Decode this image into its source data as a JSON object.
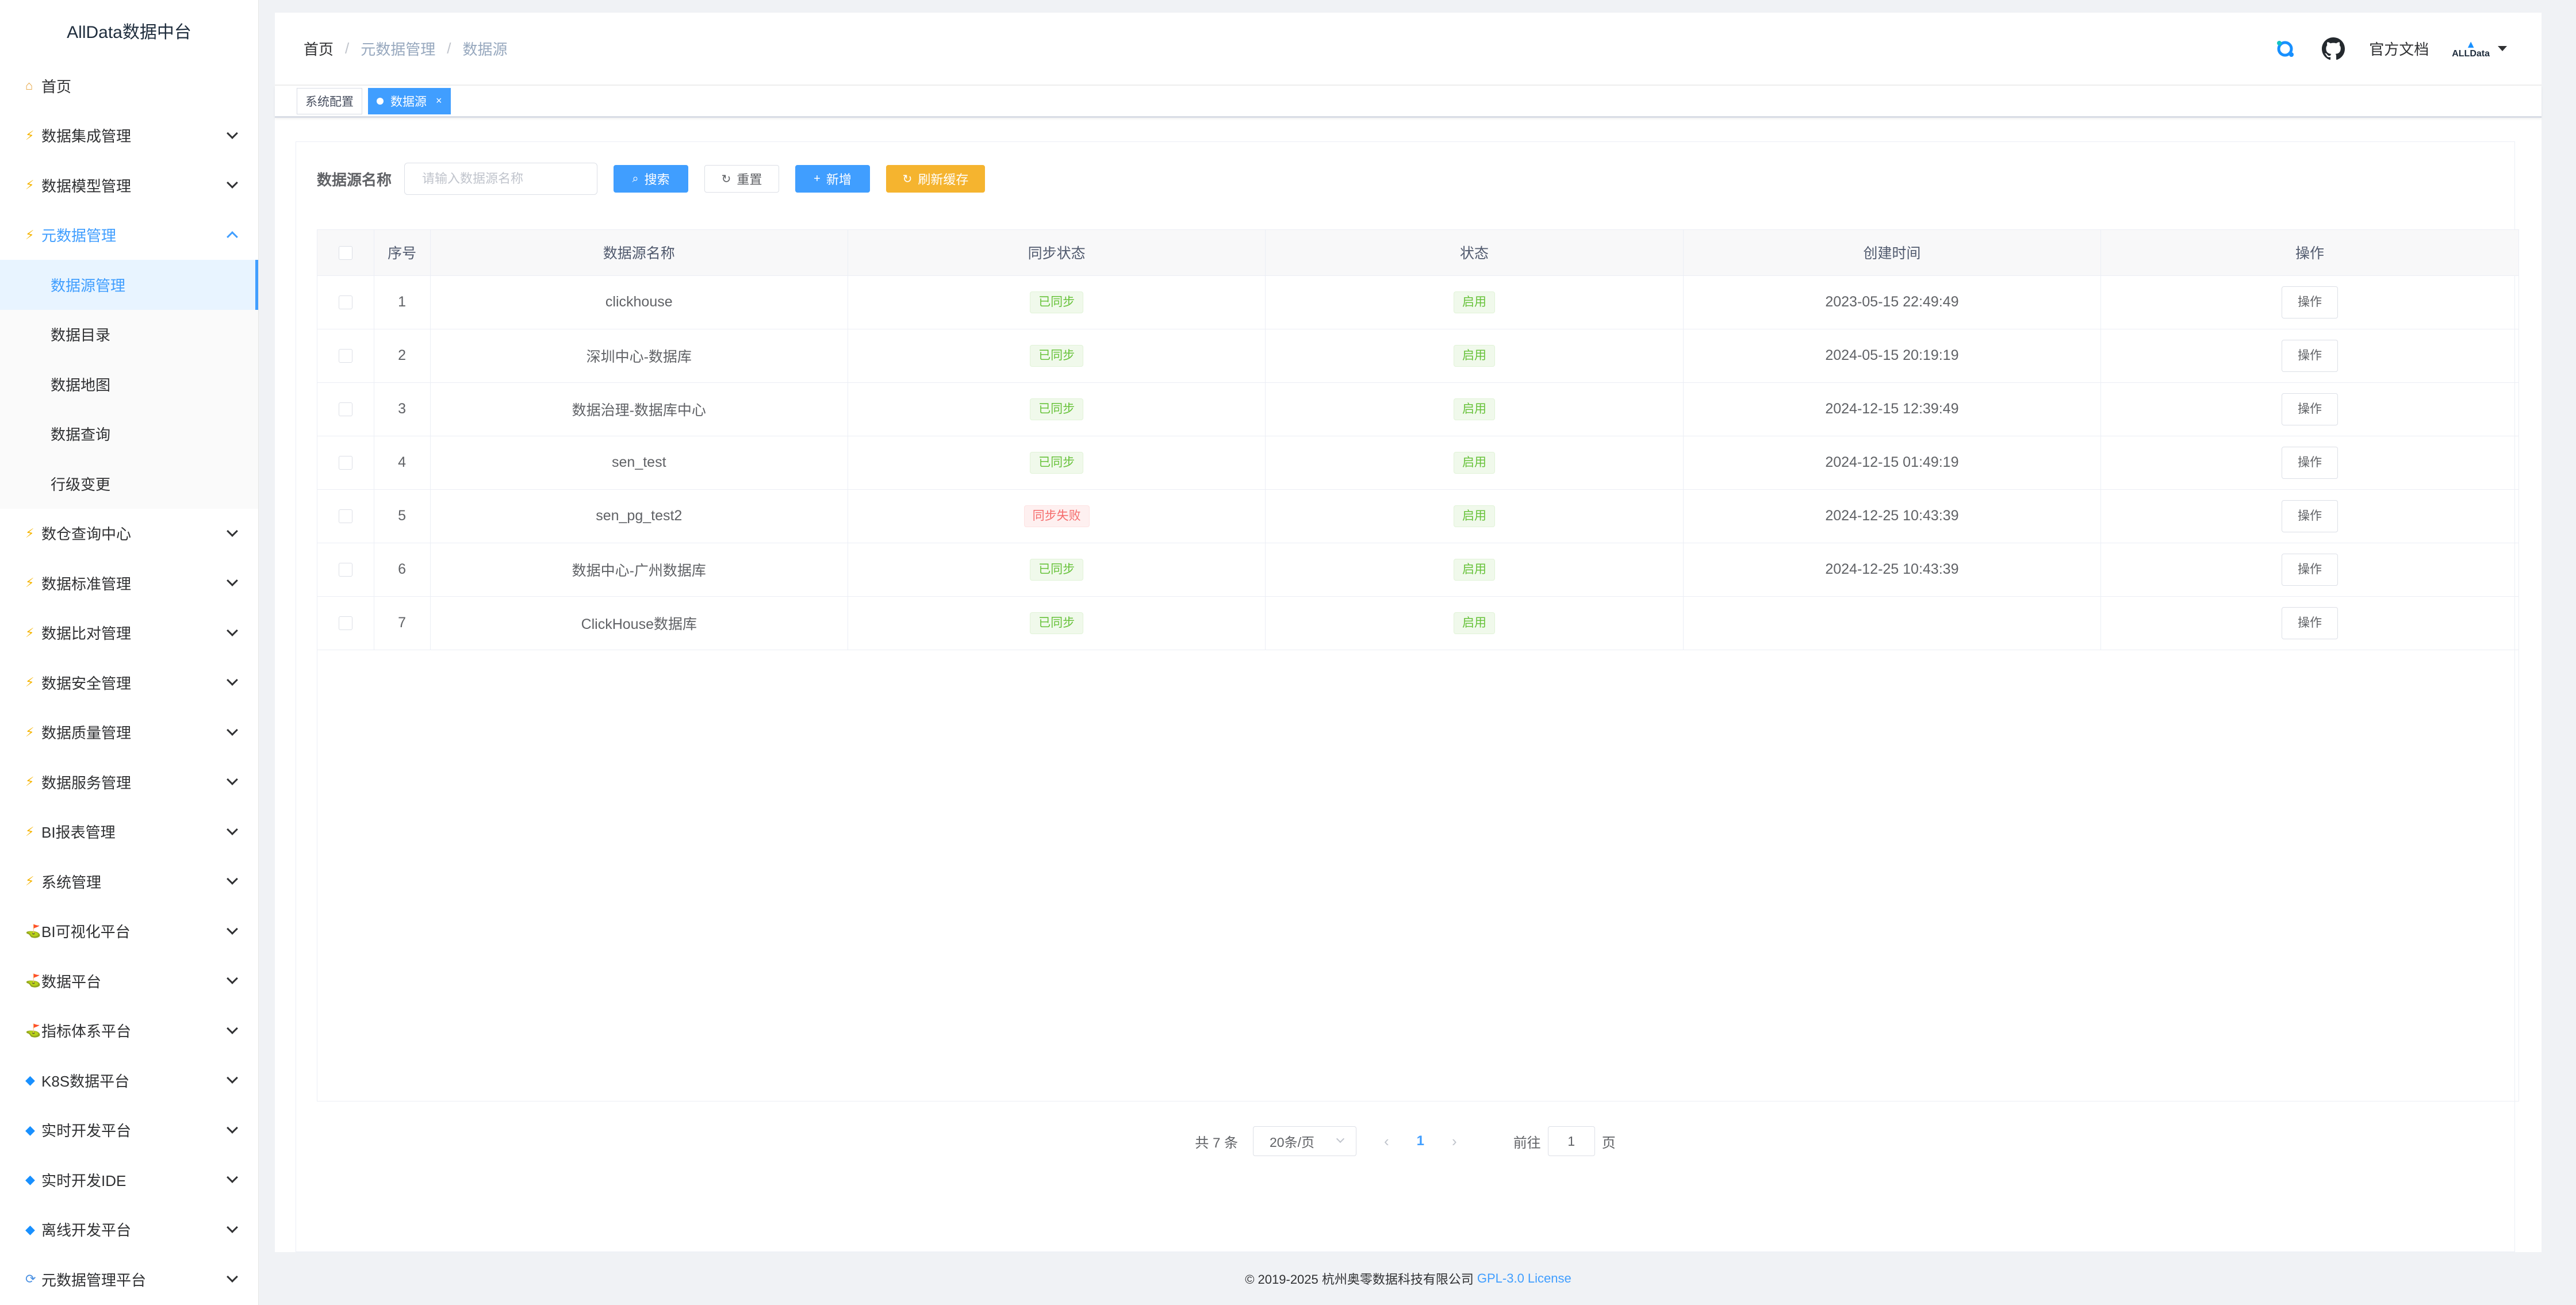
{
  "sidebar": {
    "title": "AllData数据中台",
    "home": "首页",
    "groups_top": [
      {
        "label": "数据集成管理",
        "icon": "bolt"
      },
      {
        "label": "数据模型管理",
        "icon": "bolt"
      }
    ],
    "open_group": {
      "label": "元数据管理",
      "icon": "bolt",
      "items": [
        "数据源管理",
        "数据目录",
        "数据地图",
        "数据查询",
        "行级变更"
      ],
      "active": "数据源管理"
    },
    "groups_bottom": [
      {
        "label": "数仓查询中心",
        "icon": "bolt"
      },
      {
        "label": "数据标准管理",
        "icon": "bolt"
      },
      {
        "label": "数据比对管理",
        "icon": "bolt"
      },
      {
        "label": "数据安全管理",
        "icon": "bolt"
      },
      {
        "label": "数据质量管理",
        "icon": "bolt"
      },
      {
        "label": "数据服务管理",
        "icon": "bolt"
      },
      {
        "label": "BI报表管理",
        "icon": "bolt"
      },
      {
        "label": "系统管理",
        "icon": "bolt"
      },
      {
        "label": "BI可视化平台",
        "icon": "plant"
      },
      {
        "label": "数据平台",
        "icon": "plant"
      },
      {
        "label": "指标体系平台",
        "icon": "plant"
      },
      {
        "label": "K8S数据平台",
        "icon": "gem"
      },
      {
        "label": "实时开发平台",
        "icon": "gem"
      },
      {
        "label": "实时开发IDE",
        "icon": "gem"
      },
      {
        "label": "离线开发平台",
        "icon": "gem"
      },
      {
        "label": "元数据管理平台",
        "icon": "cycle"
      }
    ]
  },
  "header": {
    "breadcrumb": [
      "首页",
      "元数据管理",
      "数据源"
    ],
    "docs": "官方文档",
    "avatar_text": "ALLData"
  },
  "tags": {
    "items": [
      {
        "label": "系统配置",
        "active": false
      },
      {
        "label": "数据源",
        "active": true
      }
    ],
    "close": "×"
  },
  "search": {
    "label": "数据源名称",
    "placeholder": "请输入数据源名称",
    "search_btn": "搜索",
    "reset_btn": "重置",
    "add_btn": "新增",
    "refresh_btn": "刷新缓存"
  },
  "table": {
    "headers": [
      "序号",
      "数据源名称",
      "同步状态",
      "状态",
      "创建时间",
      "操作"
    ],
    "rows": [
      {
        "no": "1",
        "name": "clickhouse",
        "sync": "已同步",
        "sync_ok": true,
        "status": "启用",
        "created": "2023-05-15 22:49:49",
        "op": "操作"
      },
      {
        "no": "2",
        "name": "深圳中心-数据库",
        "sync": "已同步",
        "sync_ok": true,
        "status": "启用",
        "created": "2024-05-15 20:19:19",
        "op": "操作"
      },
      {
        "no": "3",
        "name": "数据治理-数据库中心",
        "sync": "已同步",
        "sync_ok": true,
        "status": "启用",
        "created": "2024-12-15 12:39:49",
        "op": "操作"
      },
      {
        "no": "4",
        "name": "sen_test",
        "sync": "已同步",
        "sync_ok": true,
        "status": "启用",
        "created": "2024-12-15 01:49:19",
        "op": "操作"
      },
      {
        "no": "5",
        "name": "sen_pg_test2",
        "sync": "同步失败",
        "sync_ok": false,
        "status": "启用",
        "created": "2024-12-25 10:43:39",
        "op": "操作"
      },
      {
        "no": "6",
        "name": "数据中心-广州数据库",
        "sync": "已同步",
        "sync_ok": true,
        "status": "启用",
        "created": "2024-12-25 10:43:39",
        "op": "操作"
      },
      {
        "no": "7",
        "name": "ClickHouse数据库",
        "sync": "已同步",
        "sync_ok": true,
        "status": "启用",
        "created": "",
        "op": "操作"
      }
    ]
  },
  "pagination": {
    "total": "共 7 条",
    "page_size": "20条/页",
    "current": "1",
    "goto_prefix": "前往",
    "goto_value": "1",
    "goto_suffix": "页"
  },
  "footer": {
    "copyright": "© 2019-2025 杭州奥零数据科技有限公司",
    "license": "GPL-3.0 License"
  },
  "colors": {
    "primary": "#409eff",
    "warning": "#f5b42f",
    "success": "#67c23a",
    "danger": "#f56c6c"
  }
}
